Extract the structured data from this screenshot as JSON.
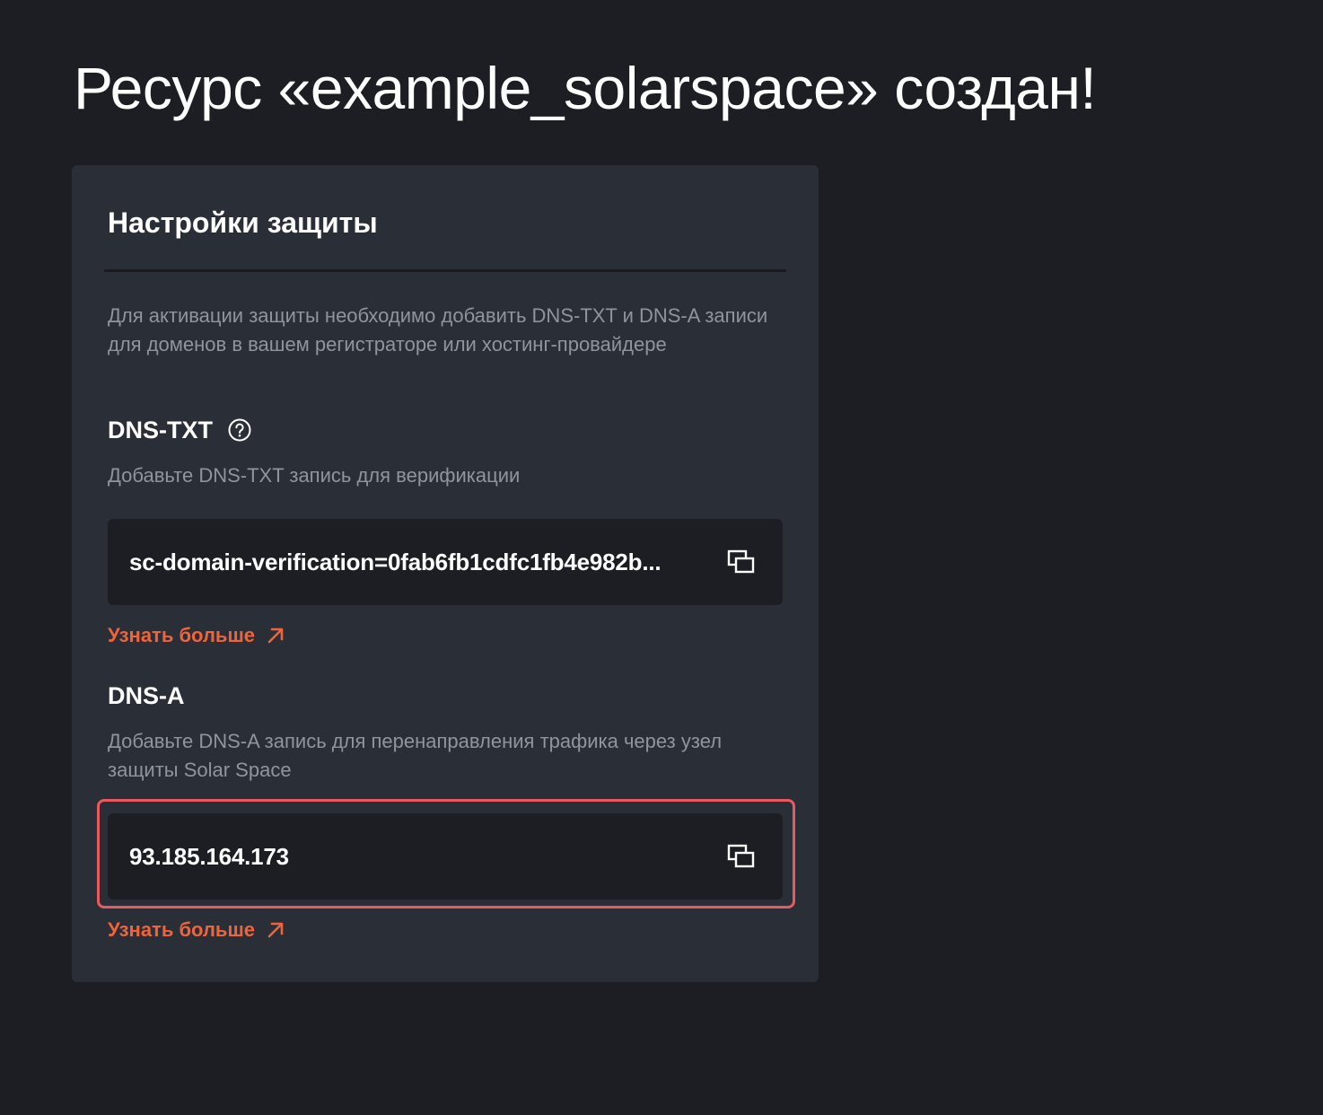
{
  "page": {
    "title": "Ресурс «example_solarspace» создан!"
  },
  "card": {
    "title": "Настройки защиты",
    "intro": "Для активации защиты необходимо добавить DNS-TXT и DNS-A записи для доменов в вашем регистраторе или хостинг-провайдере",
    "dns_txt": {
      "title": "DNS-TXT",
      "description": "Добавьте DNS-TXT запись для верификации",
      "value": "sc-domain-verification=0fab6fb1cdfc1fb4e982b...",
      "link": "Узнать больше"
    },
    "dns_a": {
      "title": "DNS-A",
      "description": "Добавьте DNS-A запись для перенаправления трафика через узел защиты Solar Space",
      "value": "93.185.164.173",
      "link": "Узнать больше"
    }
  },
  "icons": {
    "help": "help-circle-icon",
    "copy": "copy-icon",
    "external": "arrow-up-right-icon"
  },
  "colors": {
    "background": "#1c1e23",
    "card": "#2a2e36",
    "muted_text": "#8f959e",
    "link": "#f0643c",
    "highlight": "#e85a5f"
  }
}
